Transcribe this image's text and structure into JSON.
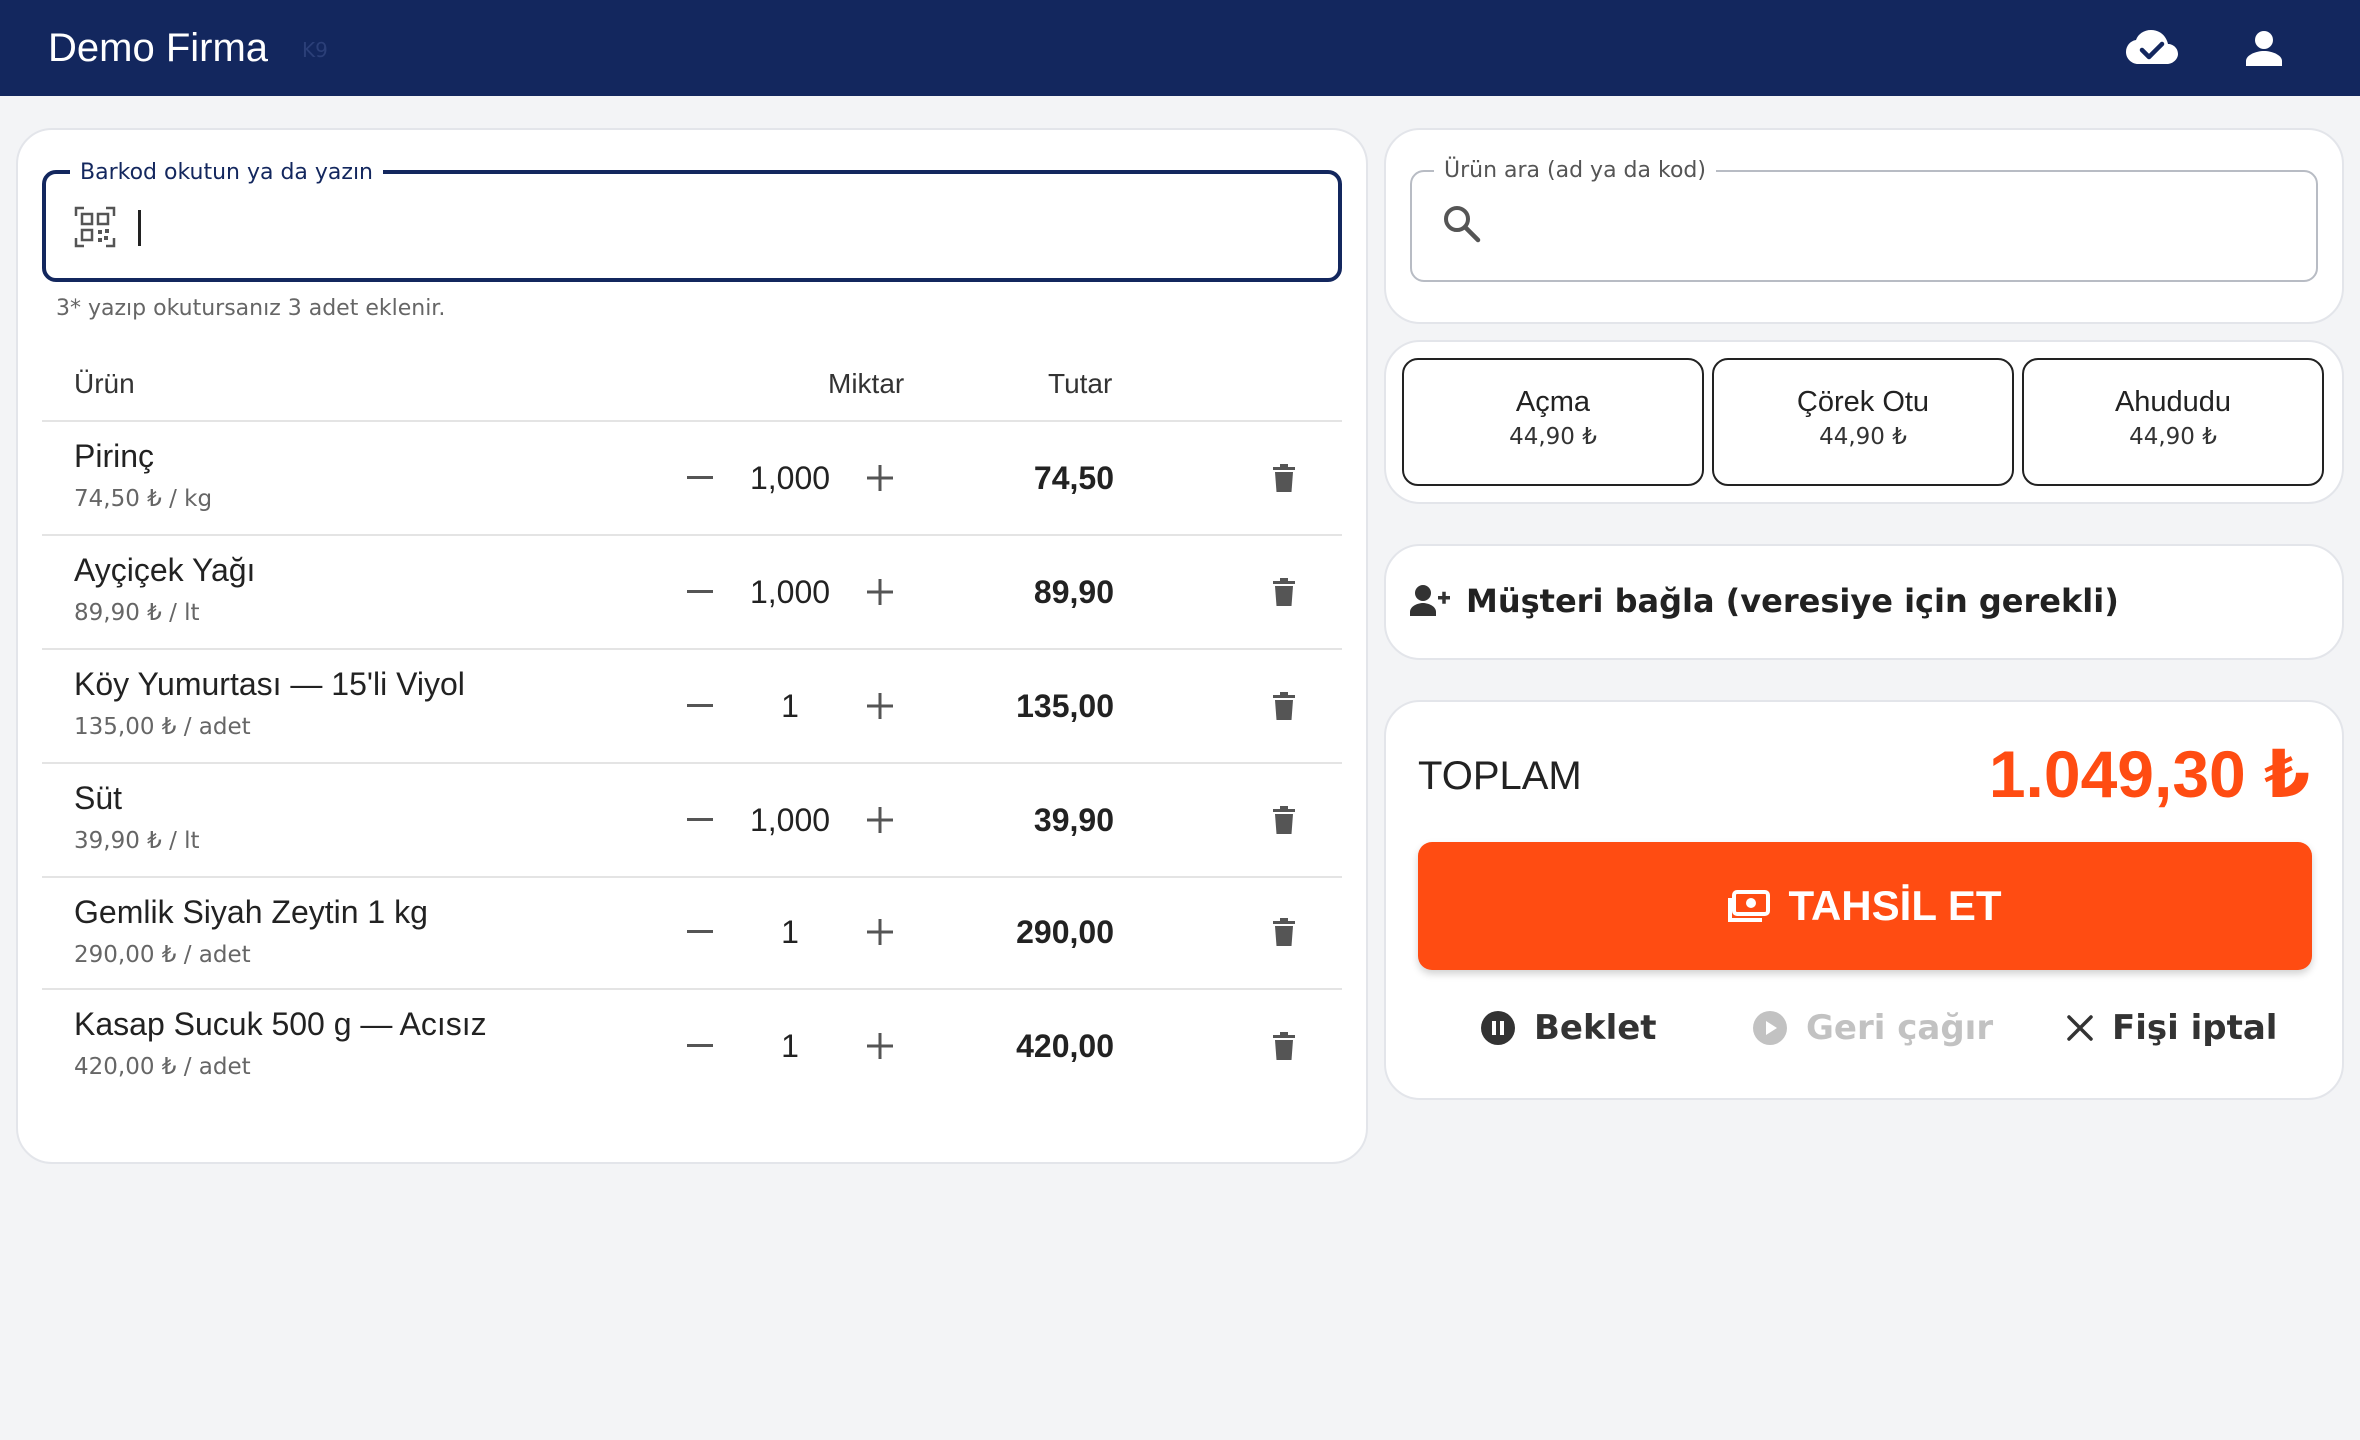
{
  "header": {
    "title": "Demo Firma",
    "badge": "K9"
  },
  "barcode": {
    "label": "Barkod okutun ya da yazın",
    "value": "",
    "hint": "3* yazıp okutursanız 3 adet eklenir."
  },
  "table": {
    "columns": {
      "product": "Ürün",
      "quantity": "Miktar",
      "amount": "Tutar"
    },
    "rows": [
      {
        "name": "Pirinç",
        "unit": "74,50 ₺ / kg",
        "qty": "1,000",
        "total": "74,50"
      },
      {
        "name": "Ayçiçek Yağı",
        "unit": "89,90 ₺ / lt",
        "qty": "1,000",
        "total": "89,90"
      },
      {
        "name": "Köy Yumurtası — 15'li Viyol",
        "unit": "135,00 ₺ / adet",
        "qty": "1",
        "total": "135,00"
      },
      {
        "name": "Süt",
        "unit": "39,90 ₺ / lt",
        "qty": "1,000",
        "total": "39,90"
      },
      {
        "name": "Gemlik Siyah Zeytin 1 kg",
        "unit": "290,00 ₺ / adet",
        "qty": "1",
        "total": "290,00"
      },
      {
        "name": "Kasap Sucuk 500 g — Acısız",
        "unit": "420,00 ₺ / adet",
        "qty": "1",
        "total": "420,00"
      }
    ]
  },
  "search": {
    "label": "Ürün ara (ad ya da kod)",
    "value": ""
  },
  "quick_items": [
    {
      "name": "Açma",
      "price": "44,90 ₺"
    },
    {
      "name": "Çörek Otu",
      "price": "44,90 ₺"
    },
    {
      "name": "Ahududu",
      "price": "44,90 ₺"
    }
  ],
  "customer": {
    "label": "Müşteri bağla (veresiye için gerekli)"
  },
  "totals": {
    "label": "TOPLAM",
    "value": "1.049,30 ₺"
  },
  "actions": {
    "pay": "TAHSİL ET",
    "hold": "Beklet",
    "recall": "Geri çağır",
    "cancel": "Fişi iptal"
  },
  "colors": {
    "header": "#13275e",
    "accent": "#ff4c12",
    "disabled": "#c2c2c2"
  },
  "icons": {
    "sync": "cloud-done-icon",
    "user": "account-icon",
    "barcode": "qr-code-scanner-icon",
    "search": "search-icon",
    "delete": "trash-icon",
    "customer": "person-add-icon",
    "pay": "payments-icon",
    "hold": "pause-circle-icon",
    "recall": "play-circle-icon",
    "cancel": "close-icon"
  }
}
